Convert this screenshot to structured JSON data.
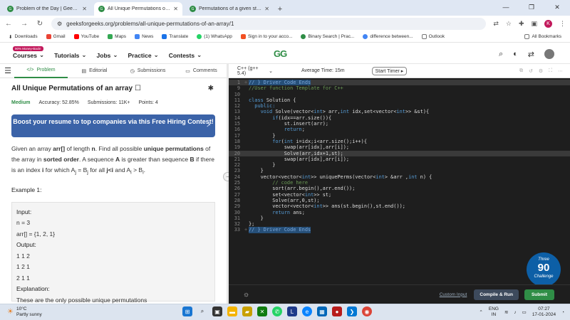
{
  "browser": {
    "tabs": [
      {
        "label": "Problem of the Day | GeeksforGeeks",
        "active": false
      },
      {
        "label": "All Unique Permutations of an array",
        "active": true
      },
      {
        "label": "Permutations of a given string",
        "active": false
      }
    ],
    "new_tab": "+",
    "window_controls": {
      "minimize": "—",
      "maximize": "❐",
      "close": "✕"
    },
    "url": "geeksforgeeks.org/problems/all-unique-permutations-of-an-array/1",
    "profile_initial": "K"
  },
  "bookmarks": {
    "items": [
      "Downloads",
      "Gmail",
      "YouTube",
      "Maps",
      "News",
      "Translate",
      "(1) WhatsApp",
      "Sign in to your acco...",
      "Binary Search | Prac...",
      "difference between...",
      "Outlook"
    ],
    "all_label": "All Bookmarks"
  },
  "site": {
    "badge": "90% Money-Back!",
    "nav": [
      "Courses",
      "Tutorials",
      "Jobs",
      "Practice",
      "Contests"
    ],
    "logo": "GG"
  },
  "problem_tabs": [
    "Problem",
    "Editorial",
    "Submissions",
    "Comments"
  ],
  "problem": {
    "title": "All Unique Permutations of an array",
    "difficulty": "Medium",
    "accuracy": "Accuracy: 52.85%",
    "submissions": "Submissions: 11K+",
    "points": "Points: 4",
    "banner": "Boost your resume to top companies via this Free Hiring Contest!",
    "desc_1": "Given an array ",
    "desc_arr": "arr[]",
    "desc_2": " of length ",
    "desc_n": "n",
    "desc_3": ". Find all possible ",
    "desc_unique": "unique permutations",
    "desc_4": " of the array in ",
    "desc_sorted": "sorted order",
    "desc_5": ". A sequence ",
    "desc_A": "A",
    "desc_6": " is greater than sequence ",
    "desc_B": "B",
    "desc_7": " if there is an index ",
    "desc_i": "i",
    "desc_8": " for which A",
    "desc_9": " = B",
    "desc_10": " for all ",
    "desc_11": "j<i",
    "desc_12": " and A",
    "desc_13": " > B",
    "desc_14": ".",
    "sub_j": "j",
    "sub_i": "i",
    "example_title": "Example 1:",
    "example": {
      "input_label": "Input:",
      "n_line": "n = 3",
      "arr_line": "arr[] = {1, 2, 1}",
      "output_label": "Output:",
      "out1": "1 1 2",
      "out2": "1 2 1",
      "out3": "2 1 1",
      "explanation_label": "Explanation:",
      "explanation": "These are the only possible unique permutations"
    }
  },
  "editor": {
    "language": "C++ (g++ 5.4)",
    "avg_time": "Average Time: 15m",
    "timer": "Start Timer",
    "lines": [
      {
        "n": "1",
        "fold": "+",
        "t": [
          {
            "c": "cmhl",
            "s": "// } Driver Code Ends"
          }
        ],
        "hl": true
      },
      {
        "n": "9",
        "fold": "",
        "t": [
          {
            "c": "cm",
            "s": "//User function Template for C++"
          }
        ]
      },
      {
        "n": "10",
        "fold": "",
        "t": []
      },
      {
        "n": "11",
        "fold": "",
        "t": [
          {
            "c": "kw",
            "s": "class"
          },
          {
            "c": "txt",
            "s": " Solution {"
          }
        ]
      },
      {
        "n": "12",
        "fold": "",
        "t": [
          {
            "c": "kw",
            "s": "  public:"
          }
        ]
      },
      {
        "n": "13",
        "fold": "",
        "t": [
          {
            "c": "kw",
            "s": "    void"
          },
          {
            "c": "txt",
            "s": " Solve(vector<"
          },
          {
            "c": "kw",
            "s": "int"
          },
          {
            "c": "txt",
            "s": "> arr,"
          },
          {
            "c": "kw",
            "s": "int"
          },
          {
            "c": "txt",
            "s": " idx,set<vector<"
          },
          {
            "c": "kw",
            "s": "int"
          },
          {
            "c": "txt",
            "s": ">> &st){"
          }
        ]
      },
      {
        "n": "14",
        "fold": "",
        "t": [
          {
            "c": "kw",
            "s": "        if"
          },
          {
            "c": "txt",
            "s": "(idx==arr.size()){"
          }
        ]
      },
      {
        "n": "15",
        "fold": "",
        "t": [
          {
            "c": "txt",
            "s": "            st.insert(arr);"
          }
        ]
      },
      {
        "n": "16",
        "fold": "",
        "t": [
          {
            "c": "kw",
            "s": "            return"
          },
          {
            "c": "txt",
            "s": ";"
          }
        ]
      },
      {
        "n": "17",
        "fold": "",
        "t": [
          {
            "c": "txt",
            "s": "        }"
          }
        ]
      },
      {
        "n": "18",
        "fold": "",
        "t": [
          {
            "c": "kw",
            "s": "        for"
          },
          {
            "c": "txt",
            "s": "("
          },
          {
            "c": "kw",
            "s": "int"
          },
          {
            "c": "txt",
            "s": " i=idx;i<arr.size();i++){"
          }
        ]
      },
      {
        "n": "19",
        "fold": "",
        "t": [
          {
            "c": "txt",
            "s": "            swap(arr[idx],arr[i]);"
          }
        ]
      },
      {
        "n": "20",
        "fold": "",
        "t": [
          {
            "c": "txt",
            "s": "            Solve(arr,idx+1,st);"
          }
        ],
        "hl": true
      },
      {
        "n": "21",
        "fold": "",
        "t": [
          {
            "c": "txt",
            "s": "            swap(arr[idx],arr[i]);"
          }
        ]
      },
      {
        "n": "22",
        "fold": "",
        "t": [
          {
            "c": "txt",
            "s": "        }"
          }
        ]
      },
      {
        "n": "23",
        "fold": "",
        "t": [
          {
            "c": "txt",
            "s": "    }"
          }
        ]
      },
      {
        "n": "24",
        "fold": "",
        "t": [
          {
            "c": "txt",
            "s": "    vector<vector<"
          },
          {
            "c": "kw",
            "s": "int"
          },
          {
            "c": "txt",
            "s": ">> uniquePerms(vector<"
          },
          {
            "c": "kw",
            "s": "int"
          },
          {
            "c": "txt",
            "s": "> &arr ,"
          },
          {
            "c": "kw",
            "s": "int"
          },
          {
            "c": "txt",
            "s": " n) {"
          }
        ]
      },
      {
        "n": "25",
        "fold": "",
        "t": [
          {
            "c": "cm",
            "s": "        // code here"
          }
        ]
      },
      {
        "n": "26",
        "fold": "",
        "t": [
          {
            "c": "txt",
            "s": "        sort(arr.begin(),arr.end());"
          }
        ]
      },
      {
        "n": "27",
        "fold": "",
        "t": [
          {
            "c": "txt",
            "s": "        set<vector<"
          },
          {
            "c": "kw",
            "s": "int"
          },
          {
            "c": "txt",
            "s": ">> st;"
          }
        ]
      },
      {
        "n": "28",
        "fold": "",
        "t": [
          {
            "c": "txt",
            "s": "        Solve(arr,0,st);"
          }
        ]
      },
      {
        "n": "29",
        "fold": "",
        "t": [
          {
            "c": "txt",
            "s": "        vector<vector<"
          },
          {
            "c": "kw",
            "s": "int"
          },
          {
            "c": "txt",
            "s": ">> ans(st.begin(),st.end());"
          }
        ]
      },
      {
        "n": "30",
        "fold": "",
        "t": [
          {
            "c": "kw",
            "s": "        return"
          },
          {
            "c": "txt",
            "s": " ans;"
          }
        ]
      },
      {
        "n": "31",
        "fold": "",
        "t": [
          {
            "c": "txt",
            "s": "    }"
          }
        ]
      },
      {
        "n": "32",
        "fold": "",
        "t": [
          {
            "c": "txt",
            "s": "};"
          }
        ]
      },
      {
        "n": "33",
        "fold": "+",
        "t": [
          {
            "c": "cmhl",
            "s": "// } Driver Code Ends"
          }
        ]
      }
    ],
    "challenge_top": "Three",
    "challenge_num": "90",
    "challenge_bottom": "Challenge",
    "custom_input": "Custom Input",
    "compile_run": "Compile & Run",
    "submit": "Submit"
  },
  "taskbar": {
    "temp": "10°C",
    "weather": "Partly sunny",
    "lang_top": "ENG",
    "lang_bottom": "IN",
    "time": "07:27",
    "date": "17-01-2024"
  },
  "colors": {
    "brand": "#2f8d46",
    "banner": "#3b63a8",
    "editor_bg": "#1e1e1e"
  }
}
